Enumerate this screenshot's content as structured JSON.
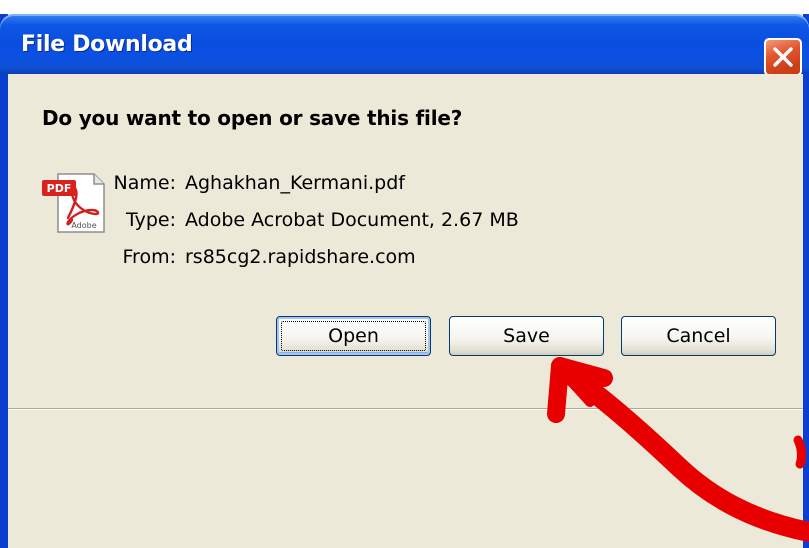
{
  "window": {
    "title": "File Download",
    "close_icon": "close-icon"
  },
  "dialog": {
    "question": "Do you want to open or save this file?",
    "file_icon": "pdf-file-icon",
    "icon_badge": "PDF",
    "icon_brand": "Adobe",
    "name_label": "Name:",
    "name_value": "Aghakhan_Kermani.pdf",
    "type_label": "Type:",
    "type_value": "Adobe Acrobat Document, 2.67 MB",
    "from_label": "From:",
    "from_value": "rs85cg2.rapidshare.com"
  },
  "buttons": {
    "open": "Open",
    "save": "Save",
    "cancel": "Cancel"
  },
  "annotation": {
    "type": "red-hand-drawn-arrow",
    "points_to": "save-button",
    "color": "#e80000"
  },
  "colors": {
    "titlebar": "#0a4ee0",
    "dialog_background": "#ece9d8",
    "close_button": "#e1552d"
  }
}
